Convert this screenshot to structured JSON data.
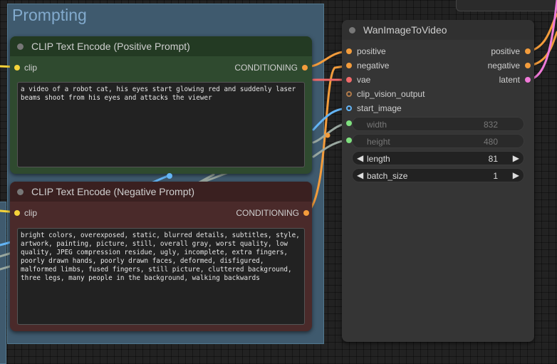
{
  "group": {
    "title": "Prompting"
  },
  "positive_node": {
    "title": "CLIP Text Encode (Positive Prompt)",
    "input_label": "clip",
    "output_label": "CONDITIONING",
    "text": "a video of a robot cat, his eyes start glowing red and suddenly laser beams shoot from his eyes and attacks the viewer"
  },
  "negative_node": {
    "title": "CLIP Text Encode (Negative Prompt)",
    "input_label": "clip",
    "output_label": "CONDITIONING",
    "text": "bright colors, overexposed, static, blurred details, subtitles, style, artwork, painting, picture, still, overall gray, worst quality, low quality, JPEG compression residue, ugly, incomplete, extra fingers, poorly drawn hands, poorly drawn faces, deformed, disfigured, malformed limbs, fused fingers, still picture, cluttered background, three legs, many people in the background, walking backwards"
  },
  "wan_node": {
    "title": "WanImageToVideo",
    "inputs": [
      "positive",
      "negative",
      "vae",
      "clip_vision_output",
      "start_image"
    ],
    "outputs": [
      "positive",
      "negative",
      "latent"
    ],
    "widgets": {
      "width": {
        "label": "width",
        "value": "832"
      },
      "height": {
        "label": "height",
        "value": "480"
      },
      "length": {
        "label": "length",
        "value": "81"
      },
      "batch_size": {
        "label": "batch_size",
        "value": "1"
      }
    }
  },
  "colors": {
    "conditioning": "#f39c3c",
    "clip": "#f5d33a",
    "vae": "#f06a6a",
    "image": "#64b5f6",
    "latent": "#f07ad8",
    "int": "#7fe07f",
    "positive_node_bg": "#2f4a2f",
    "negative_node_bg": "#4a2a2a"
  }
}
